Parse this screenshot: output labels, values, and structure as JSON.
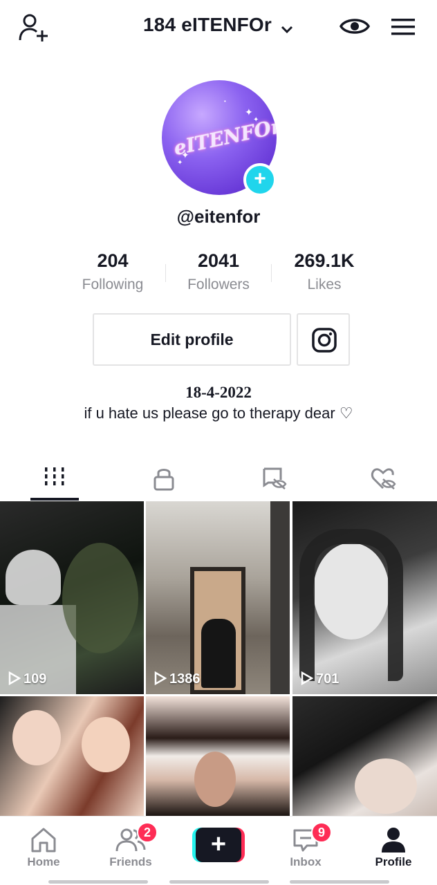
{
  "header": {
    "title": "184 eITENFOr",
    "icons": {
      "left": "add-user-icon",
      "right": [
        "eye-icon",
        "menu-icon"
      ]
    }
  },
  "profile": {
    "avatar_text": "eITENFOr",
    "username": "@eitenfor",
    "stats": [
      {
        "value": "204",
        "label": "Following"
      },
      {
        "value": "2041",
        "label": "Followers"
      },
      {
        "value": "269.1K",
        "label": "Likes"
      }
    ],
    "edit_label": "Edit profile",
    "bio_date": "18-4-2022",
    "bio_text": "if u hate us please go to therapy dear ♡"
  },
  "tabs": [
    {
      "icon": "grid-icon",
      "active": true
    },
    {
      "icon": "lock-icon",
      "active": false
    },
    {
      "icon": "tag-hidden-icon",
      "active": false
    },
    {
      "icon": "heart-hidden-icon",
      "active": false
    }
  ],
  "videos": [
    {
      "views": "109"
    },
    {
      "views": "1386"
    },
    {
      "views": "701"
    },
    {
      "views": ""
    },
    {
      "views": ""
    },
    {
      "views": ""
    }
  ],
  "nav": {
    "home": "Home",
    "friends": "Friends",
    "friends_badge": "2",
    "create": "+",
    "inbox": "Inbox",
    "inbox_badge": "9",
    "profile": "Profile"
  },
  "colors": {
    "accent_cyan": "#20d5ec",
    "accent_red": "#fe2c55",
    "text": "#161823",
    "muted": "#8a8b91"
  }
}
